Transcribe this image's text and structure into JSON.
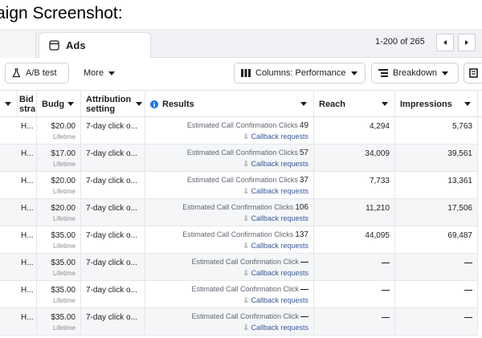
{
  "caption": "aign Screenshot:",
  "tabs": {
    "ads_label": "Ads"
  },
  "pager": {
    "range": "1-200 of 265"
  },
  "toolbar": {
    "ab_test": "A/B test",
    "more": "More",
    "columns": "Columns: Performance",
    "breakdown": "Breakdown"
  },
  "table": {
    "headers": {
      "bid": "Bid stra",
      "budget": "Budg",
      "attribution": "Attribution setting",
      "results": "Results",
      "reach": "Reach",
      "impressions": "Impressions"
    },
    "rows": [
      {
        "bid": "H...",
        "budget": "$20.00",
        "budget_sub": "Lifetime",
        "attr": "7-day click o...",
        "res_label": "Estimated Call Confirmation Clicks",
        "res_num": "49",
        "res_sub": "Callback requests",
        "reach": "4,294",
        "imp": "5,763"
      },
      {
        "bid": "H...",
        "budget": "$17.00",
        "budget_sub": "Lifetime",
        "attr": "7-day click o...",
        "res_label": "Estimated Call Confirmation Clicks",
        "res_num": "57",
        "res_sub": "Callback requests",
        "reach": "34,009",
        "imp": "39,561"
      },
      {
        "bid": "H...",
        "budget": "$20.00",
        "budget_sub": "Lifetime",
        "attr": "7-day click o...",
        "res_label": "Estimated Call Confirmation Clicks",
        "res_num": "37",
        "res_sub": "Callback requests",
        "reach": "7,733",
        "imp": "13,361"
      },
      {
        "bid": "H...",
        "budget": "$20.00",
        "budget_sub": "Lifetime",
        "attr": "7-day click o...",
        "res_label": "Estimated Call Confirmation Clicks",
        "res_num": "106",
        "res_sub": "Callback requests",
        "reach": "11,210",
        "imp": "17,506"
      },
      {
        "bid": "H...",
        "budget": "$35.00",
        "budget_sub": "Lifetime",
        "attr": "7-day click o...",
        "res_label": "Estimated Call Confirmation Clicks",
        "res_num": "137",
        "res_sub": "Callback requests",
        "reach": "44,095",
        "imp": "69,487"
      },
      {
        "bid": "H...",
        "budget": "$35.00",
        "budget_sub": "Lifetime",
        "attr": "7-day click o...",
        "res_label": "Estimated Call Confirmation Click",
        "res_num": "—",
        "res_sub": "Callback requests",
        "reach": "—",
        "imp": "—"
      },
      {
        "bid": "H...",
        "budget": "$35.00",
        "budget_sub": "Lifetime",
        "attr": "7-day click o...",
        "res_label": "Estimated Call Confirmation Click",
        "res_num": "—",
        "res_sub": "Callback requests",
        "reach": "—",
        "imp": "—"
      },
      {
        "bid": "H...",
        "budget": "$35.00",
        "budget_sub": "Lifetime",
        "attr": "7-day click o...",
        "res_label": "Estimated Call Confirmation Click",
        "res_num": "—",
        "res_sub": "Callback requests",
        "reach": "—",
        "imp": "—"
      }
    ]
  },
  "colors": {
    "link": "#385898",
    "info": "#1877f2"
  }
}
